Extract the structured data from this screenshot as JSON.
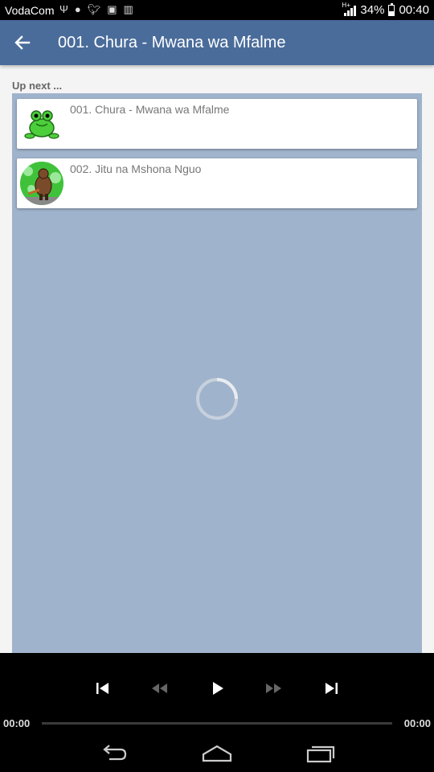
{
  "status_bar": {
    "carrier": "VodaCom",
    "network_label": "H+",
    "battery": "34%",
    "time": "00:40",
    "icons": [
      "usb-icon",
      "music-notification-icon",
      "twitter-icon",
      "wifi-icon",
      "storage-icon"
    ]
  },
  "app_bar": {
    "title": "001. Chura - Mwana wa Mfalme"
  },
  "queue": {
    "heading": "Up next ...",
    "items": [
      {
        "title": "001. Chura - Mwana wa Mfalme",
        "thumb": "frog-thumbnail"
      },
      {
        "title": "002. Jitu na Mshona Nguo",
        "thumb": "giant-thumbnail"
      }
    ]
  },
  "player": {
    "elapsed": "00:00",
    "duration": "00:00",
    "progress": 0
  },
  "colors": {
    "app_bar": "#4a6c9b",
    "panel": "#a0b3cc",
    "player": "#000000"
  }
}
